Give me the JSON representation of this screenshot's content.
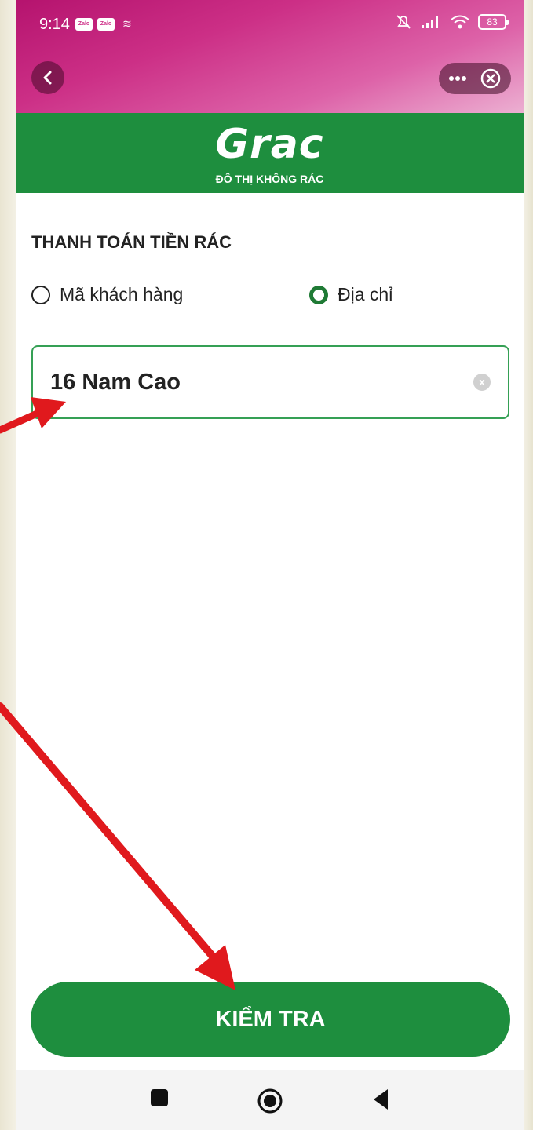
{
  "status_bar": {
    "time": "9:14",
    "notification_icons": [
      "Zalo",
      "Zalo"
    ],
    "battery": "83"
  },
  "header": {
    "back_icon": "chevron-left-icon",
    "more_icon": "more-icon",
    "close_icon": "close-circle-icon"
  },
  "brand": {
    "logo_text": "Grac",
    "tagline": "ĐÔ THỊ KHÔNG RÁC",
    "color": "#1e8e3e"
  },
  "form": {
    "title": "THANH TOÁN TIỀN RÁC",
    "options": [
      {
        "label": "Mã khách hàng",
        "selected": false
      },
      {
        "label": "Địa chỉ",
        "selected": true
      }
    ],
    "address_value": "16 Nam Cao",
    "clear_label": "x"
  },
  "actions": {
    "check_label": "KIỂM TRA"
  },
  "annotation_color": "#e0191d"
}
